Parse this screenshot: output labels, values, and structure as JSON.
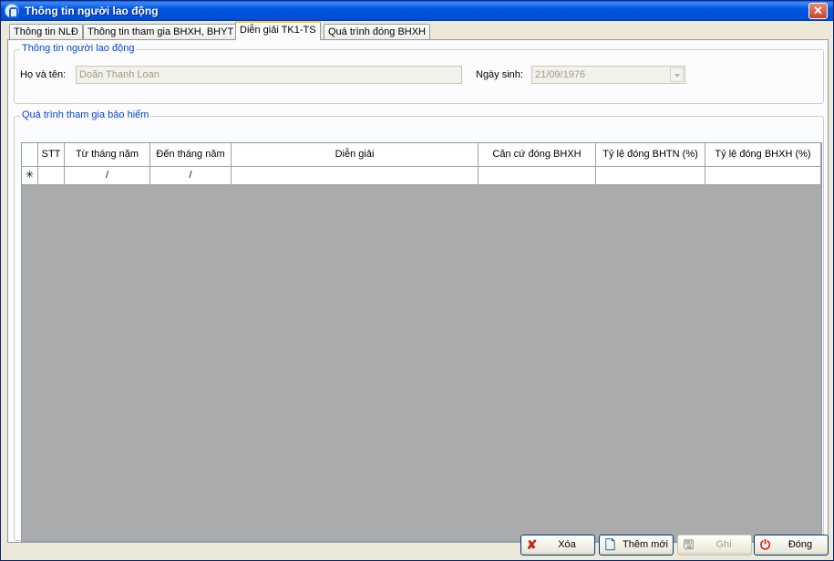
{
  "window": {
    "title": "Thông tin người lao động",
    "close_glyph": "✕"
  },
  "tabs": [
    {
      "label": "Thông tin NLĐ",
      "active": false
    },
    {
      "label": "Thông tin tham gia BHXH, BHYT",
      "active": false
    },
    {
      "label": "Diễn giải TK1-TS",
      "active": true
    },
    {
      "label": "Quá trình đóng BHXH",
      "active": false
    }
  ],
  "worker_group": {
    "legend": "Thông tin người lao động",
    "name_label": "Họ và tên:",
    "name_value": "Doãn Thanh Loan",
    "dob_label": "Ngày sinh:",
    "dob_value": "21/09/1976"
  },
  "insurance_group": {
    "legend": "Quá trình tham gia bảo hiểm"
  },
  "grid": {
    "columns": [
      "STT",
      "Từ tháng năm",
      "Đến tháng năm",
      "Diễn giải",
      "Căn cứ đóng BHXH",
      "Tỷ lệ đóng BHTN (%)",
      "Tỷ lệ đóng BHXH (%)"
    ],
    "new_row": {
      "marker": "✳",
      "stt": "",
      "from": "/",
      "to": "/",
      "desc": "",
      "base": "",
      "bhtn": "",
      "bhxh": ""
    }
  },
  "buttons": {
    "delete": {
      "label": "Xóa",
      "icon": "delete-icon",
      "glyph": "✘",
      "color": "#c0281c"
    },
    "add": {
      "label": "Thêm mới",
      "icon": "new-document-icon",
      "glyph": "🗋",
      "color": "#2a5db0"
    },
    "save": {
      "label": "Ghi",
      "icon": "save-icon",
      "glyph": "🖫",
      "color": "#a4a399"
    },
    "close": {
      "label": "Đóng",
      "icon": "power-icon",
      "glyph": "⏻",
      "color": "#d2221a"
    }
  }
}
